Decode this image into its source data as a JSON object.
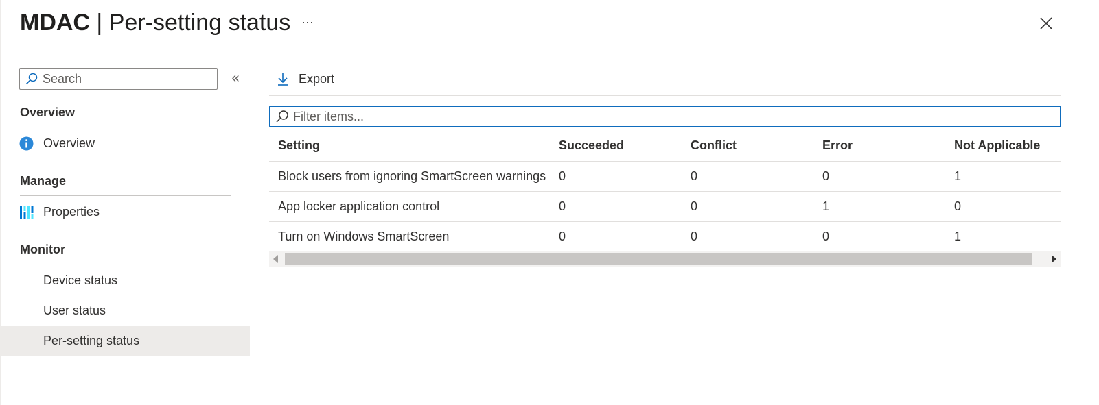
{
  "header": {
    "title_brand": "MDAC",
    "title_separator": " | ",
    "title_page": "Per-setting status",
    "more_label": "···"
  },
  "sidebar": {
    "search_placeholder": "Search",
    "collapse_label": "«",
    "sections": [
      {
        "heading": "Overview",
        "items": [
          {
            "label": "Overview",
            "icon": "info-icon"
          }
        ]
      },
      {
        "heading": "Manage",
        "items": [
          {
            "label": "Properties",
            "icon": "properties-icon"
          }
        ]
      },
      {
        "heading": "Monitor",
        "items": [
          {
            "label": "Device status"
          },
          {
            "label": "User status"
          },
          {
            "label": "Per-setting status",
            "selected": true
          }
        ]
      }
    ]
  },
  "toolbar": {
    "export_label": "Export",
    "icon": "download-icon"
  },
  "filter": {
    "placeholder": "Filter items..."
  },
  "table": {
    "columns": [
      "Setting",
      "Succeeded",
      "Conflict",
      "Error",
      "Not Applicable"
    ],
    "rows": [
      [
        "Block users from ignoring SmartScreen warnings",
        "0",
        "0",
        "0",
        "1"
      ],
      [
        "App locker application control",
        "0",
        "0",
        "1",
        "0"
      ],
      [
        "Turn on Windows SmartScreen",
        "0",
        "0",
        "0",
        "1"
      ]
    ]
  },
  "colors": {
    "accent": "#0f6cbd",
    "selected_bg": "#edebe9",
    "info_icon": "#2b88d8"
  }
}
